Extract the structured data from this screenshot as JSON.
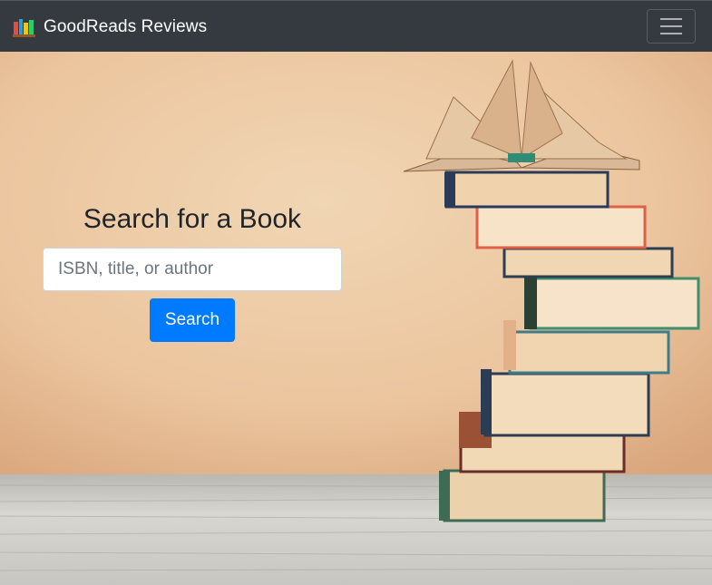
{
  "navbar": {
    "brand_label": "GoodReads Reviews",
    "brand_icon": "books-icon",
    "menu_icon": "hamburger-menu-icon"
  },
  "search": {
    "heading": "Search for a Book",
    "placeholder": "ISBN, title, or author",
    "value": "",
    "button_label": "Search"
  },
  "colors": {
    "navbar_bg": "#343a40",
    "button_bg": "#007bff",
    "hero_wall": "#e9c9a4"
  }
}
